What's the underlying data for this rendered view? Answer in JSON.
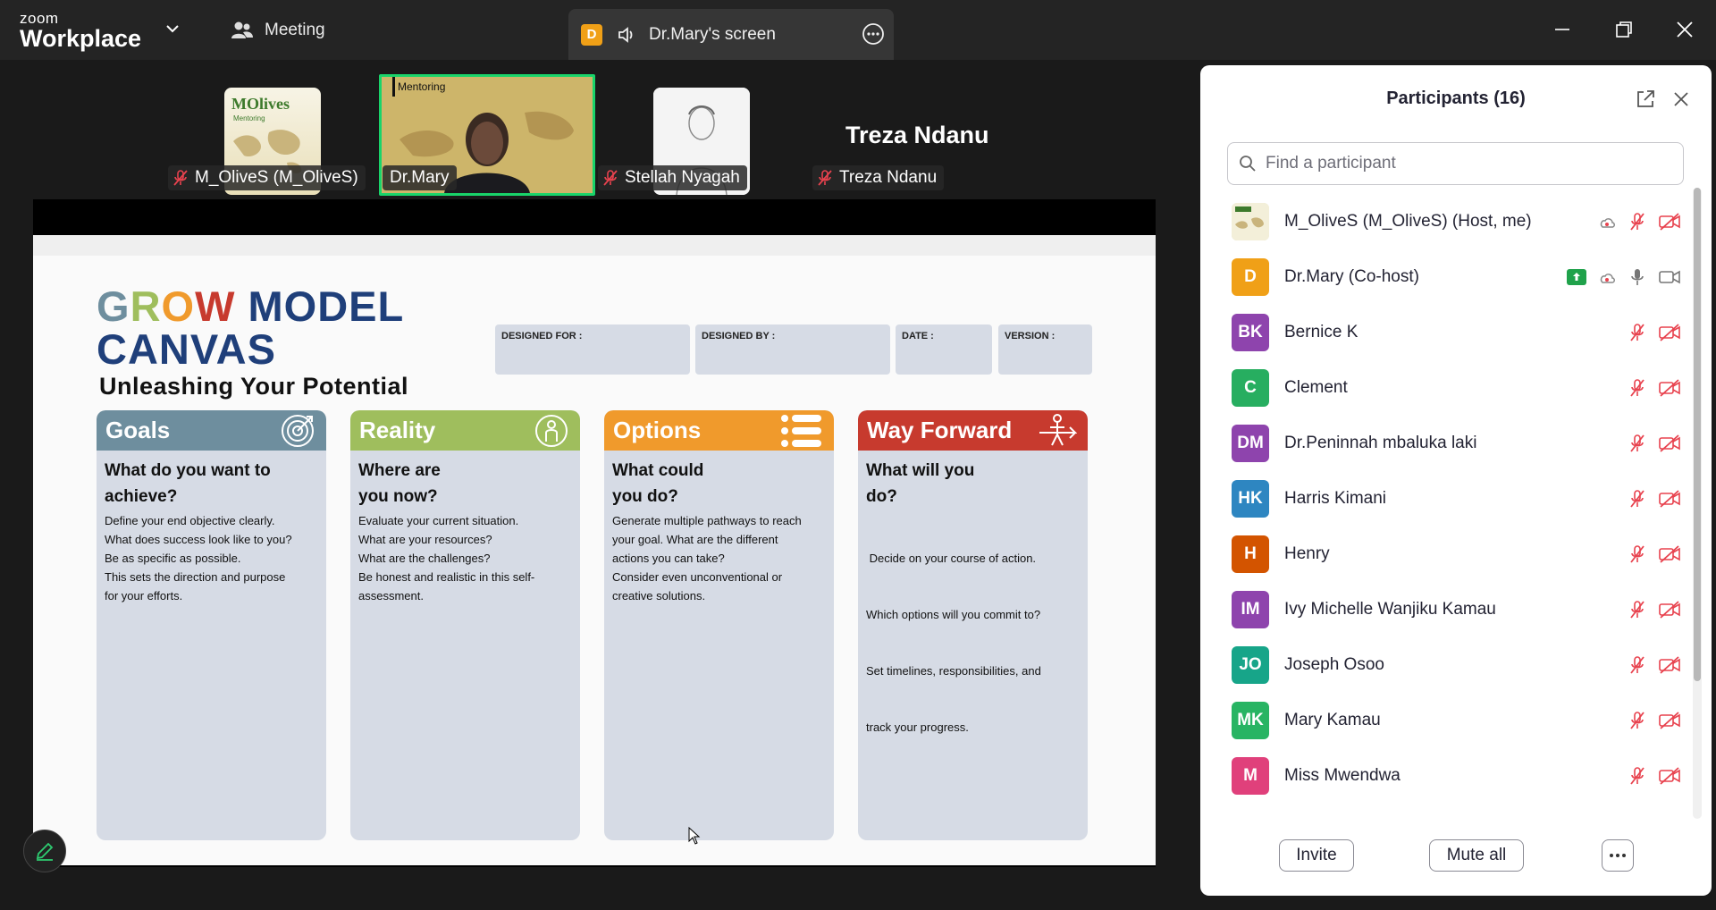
{
  "app": {
    "logo_top": "zoom",
    "logo_bottom": "Workplace",
    "meeting_label": "Meeting",
    "share_badge": "D",
    "share_label": "Dr.Mary's screen"
  },
  "videos": {
    "thumb1_name": "M_OliveS (M_OliveS)",
    "thumb1_logo": "MOlives",
    "thumb1_logo_sub": "Mentoring",
    "thumb2_name": "Dr.Mary",
    "thumb2_caption": "Mentoring",
    "thumb3_name": "Stellah Nyagah",
    "thumb4_name": "Treza Ndanu",
    "thumb4_big": "Treza Ndanu"
  },
  "slide": {
    "title_line1_colored": [
      "G",
      "R",
      "O",
      "W"
    ],
    "title_line1_rest": " MODEL",
    "title_line2": "CANVAS",
    "subtitle": "Unleashing Your Potential",
    "meta": [
      "DESIGNED FOR :",
      "DESIGNED BY :",
      "DATE :",
      "VERSION :"
    ],
    "columns": [
      {
        "header": "Goals",
        "question": "What do you want to achieve?",
        "desc": [
          "Define your end objective clearly.",
          "What does success look like to you?",
          "Be as specific as possible.",
          "This sets the direction and purpose",
          "for your efforts."
        ],
        "color": "#6e8e9e"
      },
      {
        "header": "Reality",
        "question": "Where are you now?",
        "desc": [
          "Evaluate your current situation.",
          "What are your resources?",
          "What are the challenges?",
          "Be honest and realistic in this self-",
          "assessment."
        ],
        "color": "#9fbe5d"
      },
      {
        "header": "Options",
        "question": "What could you do?",
        "desc": [
          "Generate multiple pathways to reach",
          "your goal. What are the different",
          "actions you can take?",
          "Consider even unconventional or",
          "creative solutions."
        ],
        "color": "#f09a2c"
      },
      {
        "header": "Way Forward",
        "question": "What will you do?",
        "desc": [
          " Decide on your course of action.",
          "Which options will you commit to?",
          "Set timelines, responsibilities, and",
          "track your progress."
        ],
        "color": "#c73a2e"
      }
    ]
  },
  "participants": {
    "title": "Participants (16)",
    "search_placeholder": "Find a participant",
    "list": [
      {
        "name": "M_OliveS (M_OliveS) (Host, me)",
        "initials": "",
        "color": "#e6e2c8",
        "state": "host"
      },
      {
        "name": "Dr.Mary (Co-host)",
        "initials": "D",
        "color": "#f0a017",
        "state": "cohost"
      },
      {
        "name": "Bernice K",
        "initials": "BK",
        "color": "#8e44ad",
        "state": "muted"
      },
      {
        "name": "Clement",
        "initials": "C",
        "color": "#27ae60",
        "state": "muted"
      },
      {
        "name": "Dr.Peninnah mbaluka  laki",
        "initials": "DM",
        "color": "#8e44ad",
        "state": "muted"
      },
      {
        "name": "Harris Kimani",
        "initials": "HK",
        "color": "#2e86c1",
        "state": "muted"
      },
      {
        "name": "Henry",
        "initials": "H",
        "color": "#d35400",
        "state": "muted"
      },
      {
        "name": "Ivy Michelle Wanjiku Kamau",
        "initials": "IM",
        "color": "#8e44ad",
        "state": "muted"
      },
      {
        "name": "Joseph Osoo",
        "initials": "JO",
        "color": "#17a589",
        "state": "muted"
      },
      {
        "name": "Mary Kamau",
        "initials": "MK",
        "color": "#28b463",
        "state": "muted"
      },
      {
        "name": "Miss Mwendwa",
        "initials": "M",
        "color": "#e0407b",
        "state": "muted"
      }
    ],
    "invite_label": "Invite",
    "mute_all_label": "Mute all"
  }
}
